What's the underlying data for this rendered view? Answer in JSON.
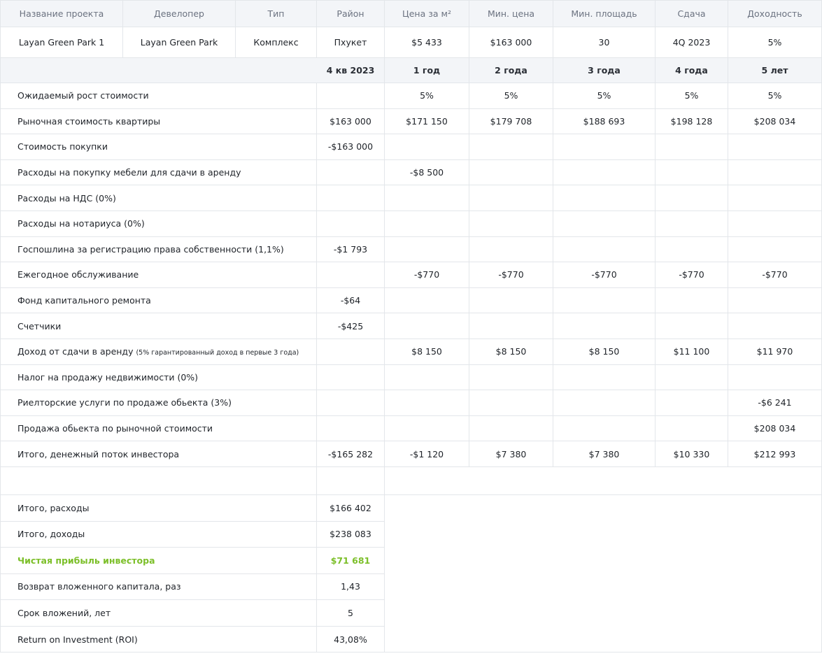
{
  "header": {
    "columns": [
      "Название проекта",
      "Девелопер",
      "Тип",
      "Район",
      "Цена за м²",
      "Мин. цена",
      "Мин. площадь",
      "Сдача",
      "Доходность"
    ]
  },
  "project": {
    "name": "Layan Green Park 1",
    "developer": "Layan Green Park",
    "type": "Комплекс",
    "district": "Пхукет",
    "price_per_m2": "$5 433",
    "min_price": "$163 000",
    "min_area": "30",
    "completion": "4Q 2023",
    "yield": "5%"
  },
  "periods": [
    "4 кв 2023",
    "1 год",
    "2 года",
    "3 года",
    "4 года",
    "5 лет"
  ],
  "rows": [
    {
      "label": "Ожидаемый рост стоимости",
      "note": "",
      "values": [
        "",
        "5%",
        "5%",
        "5%",
        "5%",
        "5%"
      ]
    },
    {
      "label": "Рыночная стоимость квартиры",
      "note": "",
      "values": [
        "$163 000",
        "$171 150",
        "$179 708",
        "$188 693",
        "$198 128",
        "$208 034"
      ]
    },
    {
      "label": "Стоимость покупки",
      "note": "",
      "values": [
        "-$163 000",
        "",
        "",
        "",
        "",
        ""
      ]
    },
    {
      "label": "Расходы на покупку мебели для сдачи в аренду",
      "note": "",
      "values": [
        "",
        "-$8 500",
        "",
        "",
        "",
        ""
      ]
    },
    {
      "label": "Расходы на НДС (0%)",
      "note": "",
      "values": [
        "",
        "",
        "",
        "",
        "",
        ""
      ]
    },
    {
      "label": "Расходы на нотариуса (0%)",
      "note": "",
      "values": [
        "",
        "",
        "",
        "",
        "",
        ""
      ]
    },
    {
      "label": "Госпошлина за регистрацию права собственности (1,1%)",
      "note": "",
      "values": [
        "-$1 793",
        "",
        "",
        "",
        "",
        ""
      ]
    },
    {
      "label": "Ежегодное обслуживание",
      "note": "",
      "values": [
        "",
        "-$770",
        "-$770",
        "-$770",
        "-$770",
        "-$770"
      ]
    },
    {
      "label": "Фонд капитального ремонта",
      "note": "",
      "values": [
        "-$64",
        "",
        "",
        "",
        "",
        ""
      ]
    },
    {
      "label": "Счетчики",
      "note": "",
      "values": [
        "-$425",
        "",
        "",
        "",
        "",
        ""
      ]
    },
    {
      "label": "Доход от сдачи в аренду",
      "note": "(5% гарантированный доход в первые 3 года)",
      "values": [
        "",
        "$8 150",
        "$8 150",
        "$8 150",
        "$11 100",
        "$11 970"
      ]
    },
    {
      "label": "Налог на продажу недвижимости (0%)",
      "note": "",
      "values": [
        "",
        "",
        "",
        "",
        "",
        ""
      ]
    },
    {
      "label": "Риелторские услуги по продаже обьекта (3%)",
      "note": "",
      "values": [
        "",
        "",
        "",
        "",
        "",
        "-$6 241"
      ]
    },
    {
      "label": "Продажа обьекта по рыночной стоимости",
      "note": "",
      "values": [
        "",
        "",
        "",
        "",
        "",
        "$208 034"
      ]
    },
    {
      "label": "Итого, денежный поток инвестора",
      "note": "",
      "values": [
        "-$165 282",
        "-$1 120",
        "$7 380",
        "$7 380",
        "$10 330",
        "$212 993"
      ]
    }
  ],
  "summary": [
    {
      "label": "Итого, расходы",
      "value": "$166 402",
      "highlight": false
    },
    {
      "label": "Итого, доходы",
      "value": "$238 083",
      "highlight": false
    },
    {
      "label": "Чистая прибыль инвестора",
      "value": "$71 681",
      "highlight": true
    },
    {
      "label": "Возврат вложенного капитала, раз",
      "value": "1,43",
      "highlight": false
    },
    {
      "label": "Срок вложений, лет",
      "value": "5",
      "highlight": false
    },
    {
      "label": "Return on Investment (ROI)",
      "value": "43,08%",
      "highlight": false
    }
  ],
  "colors": {
    "header_bg": "#f3f5f8",
    "border": "#e3e6ea",
    "highlight": "#7cbf29"
  }
}
